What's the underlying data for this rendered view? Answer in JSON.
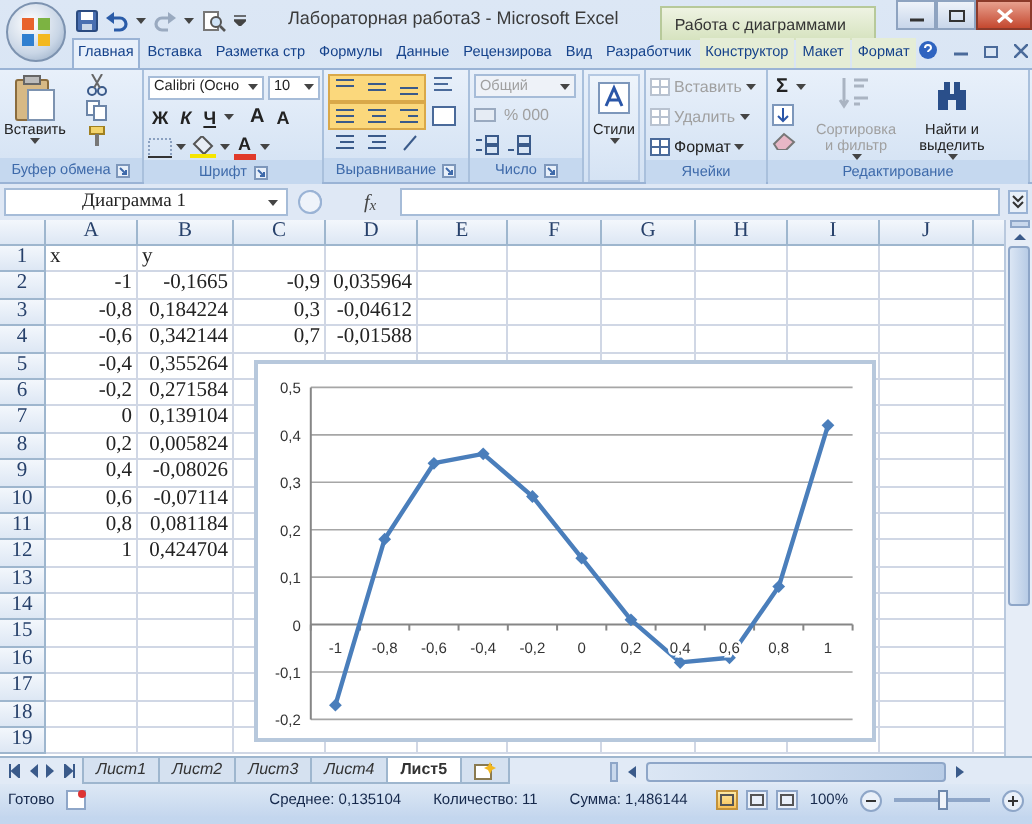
{
  "window": {
    "title": "Лабораторная работа3 - Microsoft Excel",
    "context_title": "Работа с диаграммами"
  },
  "ribbon_tabs": [
    {
      "label": "Главная",
      "selected": true
    },
    {
      "label": "Вставка",
      "selected": false
    },
    {
      "label": "Разметка стр",
      "selected": false
    },
    {
      "label": "Формулы",
      "selected": false
    },
    {
      "label": "Данные",
      "selected": false
    },
    {
      "label": "Рецензирова",
      "selected": false
    },
    {
      "label": "Вид",
      "selected": false
    },
    {
      "label": "Разработчик",
      "selected": false
    },
    {
      "label": "Конструктор",
      "selected": false
    },
    {
      "label": "Макет",
      "selected": false
    },
    {
      "label": "Формат",
      "selected": false
    }
  ],
  "ribbon": {
    "groups": [
      {
        "kind": "clipboard",
        "label": "Буфер обмена",
        "paste": "Вставить"
      },
      {
        "kind": "font",
        "label": "Шрифт",
        "font": "Calibri (Осно",
        "size": "10",
        "styles": [
          "Ж",
          "К",
          "Ч"
        ],
        "grow": "A",
        "shrink": "A",
        "color_letter": "A"
      },
      {
        "kind": "alignment",
        "label": "Выравнивание"
      },
      {
        "kind": "number",
        "label": "Число",
        "format": {
          "value": "Общий",
          "disabled": true
        },
        "percent": "%",
        "thousands": "000"
      },
      {
        "kind": "styles",
        "button": "Стили"
      },
      {
        "kind": "cells",
        "label": "Ячейки",
        "items": [
          {
            "label": "Вставить",
            "disabled": true
          },
          {
            "label": "Удалить",
            "disabled": true
          },
          {
            "label": "Формат",
            "disabled": false
          }
        ]
      },
      {
        "kind": "editing",
        "label": "Редактирование",
        "sigma": "Σ",
        "buttons": [
          {
            "label": "Сортировка и фильтр",
            "disabled": true
          },
          {
            "label": "Найти и выделить",
            "disabled": false
          }
        ]
      }
    ]
  },
  "formula_bar": {
    "name_box": "Диаграмма 1",
    "fx": "f$_{x}$"
  },
  "sheet": {
    "columns": [
      "A",
      "B",
      "C",
      "D",
      "E",
      "F",
      "G",
      "H",
      "I",
      "J"
    ],
    "rows": [
      {
        "number": "1",
        "cells": [
          {
            "text": "x",
            "numeric": false
          },
          {
            "text": "y",
            "numeric": false
          }
        ]
      },
      {
        "number": "2",
        "cells": [
          {
            "text": "-1",
            "numeric": true
          },
          {
            "text": "-0,1665",
            "numeric": true
          },
          {
            "text": "-0,9",
            "numeric": true
          },
          {
            "text": "0,035964",
            "numeric": true
          }
        ]
      },
      {
        "number": "3",
        "cells": [
          {
            "text": "-0,8",
            "numeric": true
          },
          {
            "text": "0,184224",
            "numeric": true
          },
          {
            "text": "0,3",
            "numeric": true
          },
          {
            "text": "-0,04612",
            "numeric": true
          }
        ]
      },
      {
        "number": "4",
        "cells": [
          {
            "text": "-0,6",
            "numeric": true
          },
          {
            "text": "0,342144",
            "numeric": true
          },
          {
            "text": "0,7",
            "numeric": true
          },
          {
            "text": "-0,01588",
            "numeric": true
          }
        ]
      },
      {
        "number": "5",
        "cells": [
          {
            "text": "-0,4",
            "numeric": true
          },
          {
            "text": "0,355264",
            "numeric": true
          }
        ]
      },
      {
        "number": "6",
        "cells": [
          {
            "text": "-0,2",
            "numeric": true
          },
          {
            "text": "0,271584",
            "numeric": true
          }
        ]
      },
      {
        "number": "7",
        "cells": [
          {
            "text": "0",
            "numeric": true
          },
          {
            "text": "0,139104",
            "numeric": true
          }
        ]
      },
      {
        "number": "8",
        "cells": [
          {
            "text": "0,2",
            "numeric": true
          },
          {
            "text": "0,005824",
            "numeric": true
          }
        ]
      },
      {
        "number": "9",
        "cells": [
          {
            "text": "0,4",
            "numeric": true
          },
          {
            "text": "-0,08026",
            "numeric": true
          }
        ]
      },
      {
        "number": "10",
        "cells": [
          {
            "text": "0,6",
            "numeric": true
          },
          {
            "text": "-0,07114",
            "numeric": true
          }
        ]
      },
      {
        "number": "11",
        "cells": [
          {
            "text": "0,8",
            "numeric": true
          },
          {
            "text": "0,081184",
            "numeric": true
          }
        ]
      },
      {
        "number": "12",
        "cells": [
          {
            "text": "1",
            "numeric": true
          },
          {
            "text": "0,424704",
            "numeric": true
          }
        ]
      },
      {
        "number": "13"
      },
      {
        "number": "14"
      },
      {
        "number": "15"
      },
      {
        "number": "16"
      },
      {
        "number": "17"
      },
      {
        "number": "18"
      },
      {
        "number": "19"
      }
    ]
  },
  "chart": {
    "chart_data": {
      "type": "line",
      "categories": [
        "-1",
        "-0,8",
        "-0,6",
        "-0,4",
        "-0,2",
        "0",
        "0,2",
        "0,4",
        "0,6",
        "0,8",
        "1"
      ],
      "grid": true,
      "series": [
        {
          "color": "#4a7ebb",
          "marker": "diamond",
          "values": [
            -0.17,
            0.18,
            0.34,
            0.36,
            0.27,
            0.14,
            0.01,
            -0.08,
            -0.07,
            0.08,
            0.42
          ]
        }
      ],
      "ylim": [
        -0.2,
        0.5
      ],
      "yticks": [
        {
          "value": -0.2,
          "label": "-0,2"
        },
        {
          "value": -0.1,
          "label": "-0,1"
        },
        {
          "value": 0,
          "label": "0"
        },
        {
          "value": 0.1,
          "label": "0,1"
        },
        {
          "value": 0.2,
          "label": "0,2"
        },
        {
          "value": 0.3,
          "label": "0,3"
        },
        {
          "value": 0.4,
          "label": "0,4"
        },
        {
          "value": 0.5,
          "label": "0,5"
        }
      ]
    }
  },
  "sheet_tabs": [
    {
      "label": "Лист1",
      "selected": false
    },
    {
      "label": "Лист2",
      "selected": false
    },
    {
      "label": "Лист3",
      "selected": false
    },
    {
      "label": "Лист4",
      "selected": false
    },
    {
      "label": "Лист5",
      "selected": true
    }
  ],
  "status_bar": {
    "state": "Готово",
    "average": "Среднее: 0,135104",
    "count": "Количество: 11",
    "sum": "Сумма: 1,486144",
    "view_buttons": [
      {
        "selected": true
      },
      {
        "selected": false
      },
      {
        "selected": false
      }
    ],
    "zoom": {
      "label": "100%",
      "level": 0.5
    }
  }
}
